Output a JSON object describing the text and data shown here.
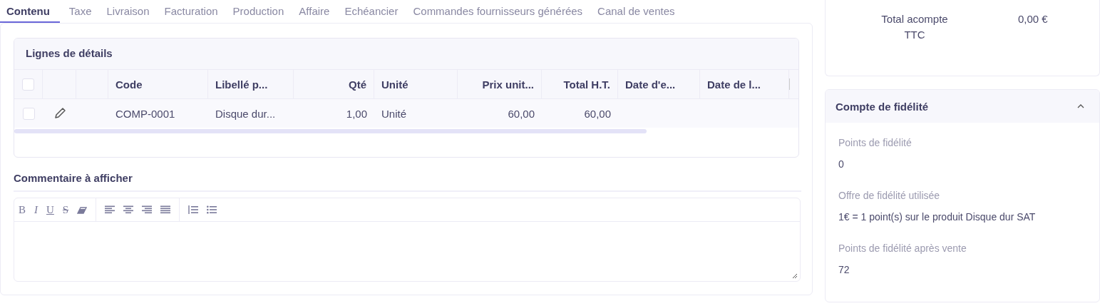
{
  "tabs": [
    {
      "label": "Contenu",
      "selected": true
    },
    {
      "label": "Taxe",
      "selected": false
    },
    {
      "label": "Livraison",
      "selected": false
    },
    {
      "label": "Facturation",
      "selected": false
    },
    {
      "label": "Production",
      "selected": false
    },
    {
      "label": "Affaire",
      "selected": false
    },
    {
      "label": "Echéancier",
      "selected": false
    },
    {
      "label": "Commandes fournisseurs générées",
      "selected": false
    },
    {
      "label": "Canal de ventes",
      "selected": false
    }
  ],
  "details": {
    "title": "Lignes de détails",
    "header_checked": false,
    "columns": [
      {
        "kind": "check"
      },
      {
        "kind": "edit"
      },
      {
        "kind": "blank"
      },
      {
        "label": "Code",
        "kind": "left"
      },
      {
        "label": "Libellé p...",
        "kind": "left"
      },
      {
        "label": "Qté",
        "kind": "right"
      },
      {
        "label": "Unité",
        "kind": "left"
      },
      {
        "label": "Prix unit...",
        "kind": "right"
      },
      {
        "label": "Total H.T.",
        "kind": "right"
      },
      {
        "label": "Date d'e...",
        "kind": "left"
      },
      {
        "label": "Date de l...",
        "kind": "left"
      }
    ],
    "rows": [
      {
        "checked": false,
        "cells": [
          "",
          "",
          "",
          "COMP-0001",
          "Disque dur...",
          "1,00",
          "Unité",
          "60,00",
          "60,00",
          "",
          ""
        ]
      }
    ]
  },
  "comment": {
    "title": "Commentaire à afficher",
    "toolbar": [
      {
        "kind": "bold",
        "glyph": "B"
      },
      {
        "kind": "italic",
        "glyph": "I"
      },
      {
        "kind": "underline",
        "glyph": "U"
      },
      {
        "kind": "strike",
        "glyph": "S"
      },
      {
        "kind": "eraser"
      },
      {
        "kind": "sep"
      },
      {
        "kind": "align-left"
      },
      {
        "kind": "align-center"
      },
      {
        "kind": "align-right"
      },
      {
        "kind": "justify"
      },
      {
        "kind": "sep"
      },
      {
        "kind": "ordered-list"
      },
      {
        "kind": "bullet-list"
      }
    ]
  },
  "totals": [
    {
      "label": "Total acompte TTC",
      "value": "0,00 €"
    }
  ],
  "loyalty": {
    "title": "Compte de fidélité",
    "expanded": true,
    "fields": [
      {
        "label": "Points de fidélité",
        "value": "0"
      },
      {
        "label": "Offre de fidélité utilisée",
        "value": "1€ = 1 point(s) sur le produit Disque dur SAT"
      },
      {
        "label": "Points de fidélité après vente",
        "value": "72"
      }
    ]
  }
}
